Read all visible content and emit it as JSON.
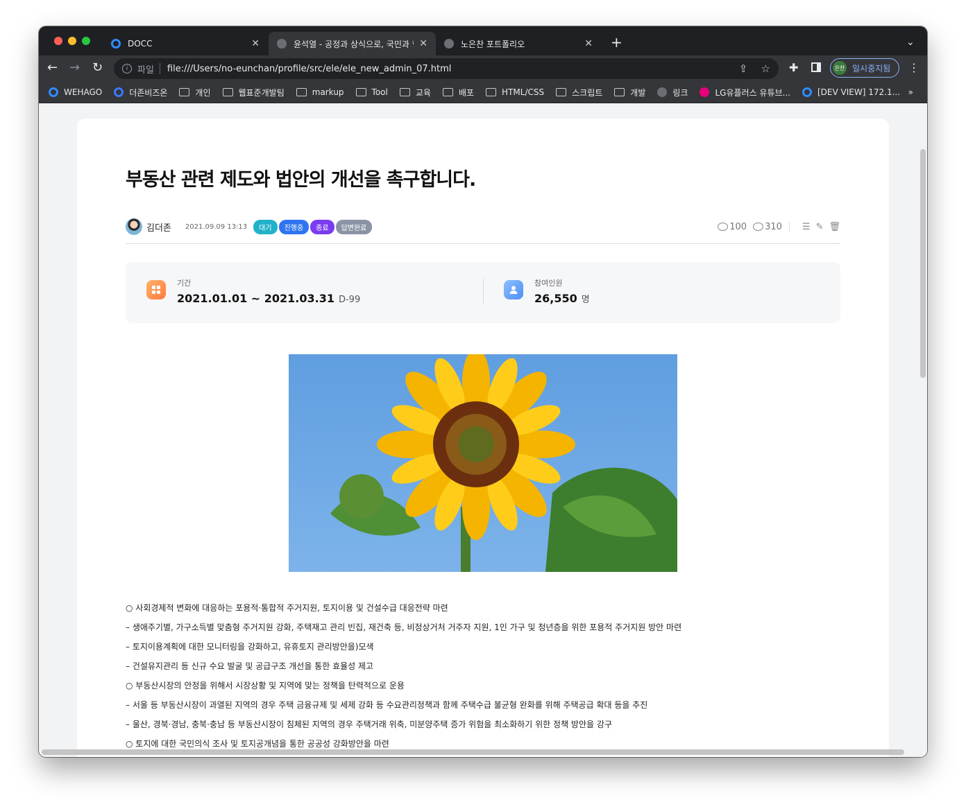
{
  "browser": {
    "tabs": [
      {
        "title": "DOCC",
        "active": false
      },
      {
        "title": "윤석열 - 공정과 상식으로, 국민과 함",
        "active": true
      },
      {
        "title": "노은찬 포트폴리오",
        "active": false
      }
    ],
    "address": {
      "scheme": "파일",
      "url": "file:///Users/no-eunchan/profile/src/ele/ele_new_admin_07.html"
    },
    "profile": {
      "avatar_text": "은찬",
      "status": "일시중지됨"
    },
    "bookmarks": [
      "WEHAGO",
      "더존비즈온",
      "개인",
      "웹표준개발팀",
      "markup",
      "Tool",
      "교육",
      "배포",
      "HTML/CSS",
      "스크립트",
      "개발",
      "링크",
      "LG유플러스 유튜브...",
      "[DEV VIEW] 172.1..."
    ],
    "bookmarks_more": "»"
  },
  "post": {
    "title": "부동산 관련 제도와 법안의 개선을 촉구합니다.",
    "author": "김더존",
    "datetime": "2021.09.09 13:13",
    "badges": [
      {
        "label": "대기",
        "color": "#22b1c9"
      },
      {
        "label": "진행중",
        "color": "#2f74f0"
      },
      {
        "label": "종료",
        "color": "#7a3cf0"
      },
      {
        "label": "답변완료",
        "color": "#8a94a6"
      }
    ],
    "comments": "100",
    "views": "310",
    "period": {
      "label": "기간",
      "value": "2021.01.01 ~ 2021.03.31",
      "dday": "D-99"
    },
    "participants": {
      "label": "참여인원",
      "value": "26,550",
      "unit": "명"
    },
    "body_lines": [
      "○ 사회경제적 변화에 대응하는 포용적·통합적 주거지원, 토지이용 및 건설수급 대응전략 마련",
      "– 생애주기별, 가구소득별 맞춤형 주거지원 강화, 주택재고 관리 빈집, 재건축 등, 비정상거처 거주자 지원, 1인 가구 및 청년층을 위한 포용적 주거지원 방안 마련",
      "– 토지이용계획에 대한 모니터링을 강화하고, 유휴토지 관리방안을)모색",
      "– 건설유지관리 등 신규 수요 발굴 및 공급구조 개선을 통한 효율성 제고",
      "○ 부동산시장의 안정을 위해서 시장상황 및 지역에 맞는 정책을 탄력적으로 운용",
      "– 서울 등 부동산시장이 과열된 지역의 경우 주택 금융규제 및 세제 강화 등 수요관리정책과 함께 주택수급 불균형 완화를 위해 주택공급 확대 등을 추진",
      "– 울산, 경북·경남, 충북·충남 등 부동산시장이 침체된 지역의 경우 주택거래 위축, 미분양주택 증가 위험을 최소화하기 위한 정책 방안을 강구",
      "○ 토지에 대한 국민의식 조사 및 토지공개념을 통한 공공성 강화방안을 마련"
    ]
  }
}
